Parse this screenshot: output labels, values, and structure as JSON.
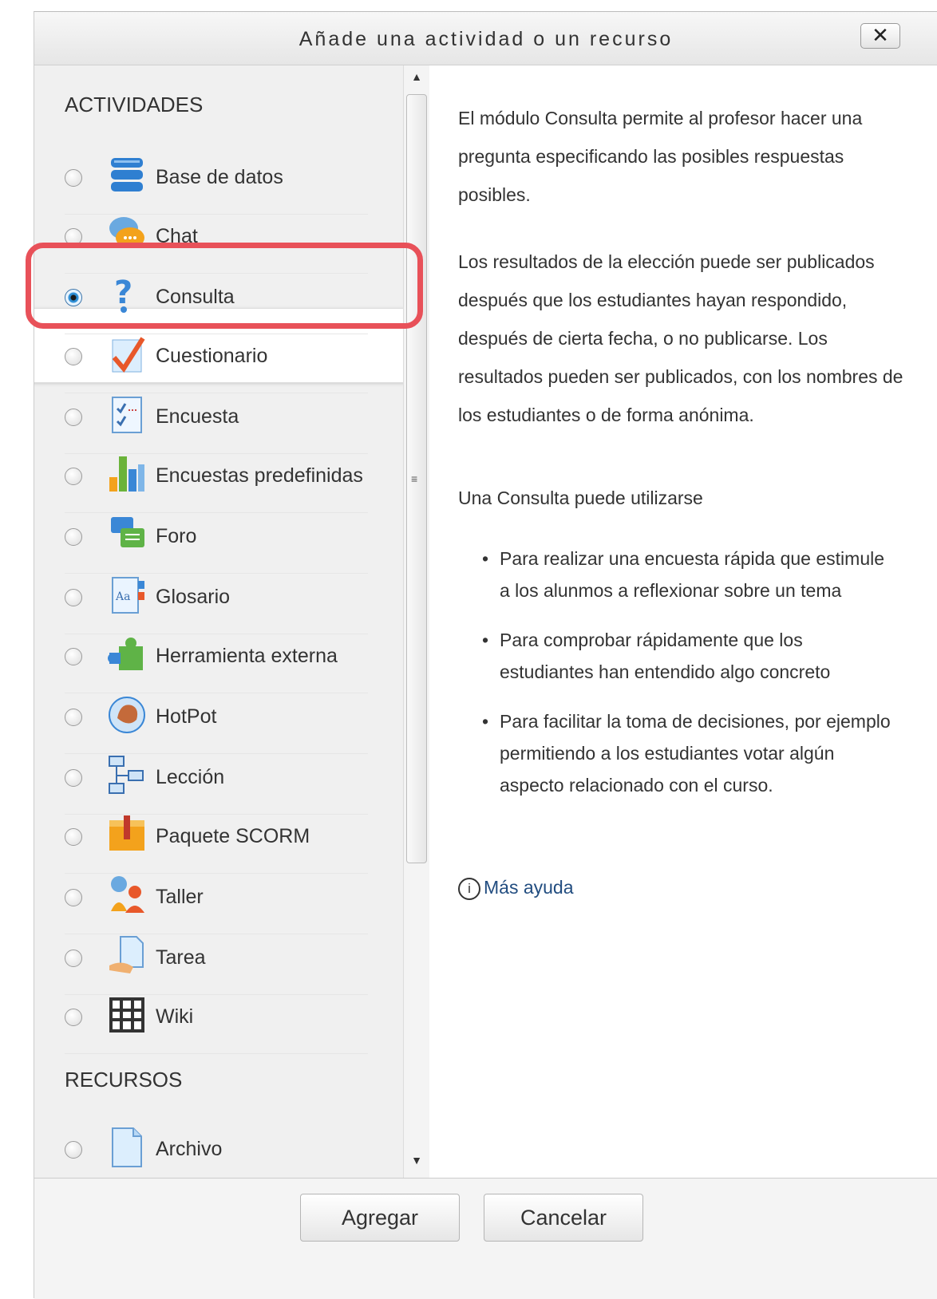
{
  "dialog": {
    "title": "Añade una actividad o un recurso",
    "close_label": "✕"
  },
  "activities": {
    "heading": "ACTIVIDADES",
    "items": [
      {
        "label": "Base de datos",
        "icon": "database-icon",
        "selected": false
      },
      {
        "label": "Chat",
        "icon": "chat-icon",
        "selected": false
      },
      {
        "label": "Consulta",
        "icon": "question-icon",
        "selected": true
      },
      {
        "label": "Cuestionario",
        "icon": "quiz-check-icon",
        "selected": false
      },
      {
        "label": "Encuesta",
        "icon": "survey-icon",
        "selected": false
      },
      {
        "label": "Encuestas predefinidas",
        "icon": "bar-chart-icon",
        "selected": false
      },
      {
        "label": "Foro",
        "icon": "forum-icon",
        "selected": false
      },
      {
        "label": "Glosario",
        "icon": "glossary-icon",
        "selected": false
      },
      {
        "label": "Herramienta externa",
        "icon": "puzzle-icon",
        "selected": false
      },
      {
        "label": "HotPot",
        "icon": "hotpot-icon",
        "selected": false
      },
      {
        "label": "Lección",
        "icon": "lesson-flow-icon",
        "selected": false
      },
      {
        "label": "Paquete SCORM",
        "icon": "scorm-package-icon",
        "selected": false
      },
      {
        "label": "Taller",
        "icon": "workshop-icon",
        "selected": false
      },
      {
        "label": "Tarea",
        "icon": "assignment-icon",
        "selected": false
      },
      {
        "label": "Wiki",
        "icon": "wiki-icon",
        "selected": false
      }
    ]
  },
  "resources": {
    "heading": "RECURSOS",
    "items": [
      {
        "label": "Archivo",
        "icon": "file-icon",
        "selected": false
      }
    ]
  },
  "description": {
    "p1": "El módulo Consulta permite al profesor hacer una pregunta especificando las posibles respuestas posibles.",
    "p2": "Los resultados de la elección puede ser publicados después que los estudiantes hayan respondido, después de cierta fecha, o no publicarse. Los resultados pueden ser publicados, con los nombres de los estudiantes o de forma anónima.",
    "p3": "Una Consulta puede utilizarse",
    "bullets": [
      "Para realizar una encuesta rápida que estimule a los alunmos a reflexionar sobre un tema",
      "Para comprobar rápidamente que los estudiantes han entendido algo concreto",
      "Para facilitar la toma de decisiones, por ejemplo permitiendo a los estudiantes votar algún aspecto relacionado con el curso."
    ],
    "help_link": "Más ayuda"
  },
  "buttons": {
    "add": "Agregar",
    "cancel": "Cancelar"
  },
  "colors": {
    "highlight_border": "#e85159",
    "link": "#224d80"
  }
}
